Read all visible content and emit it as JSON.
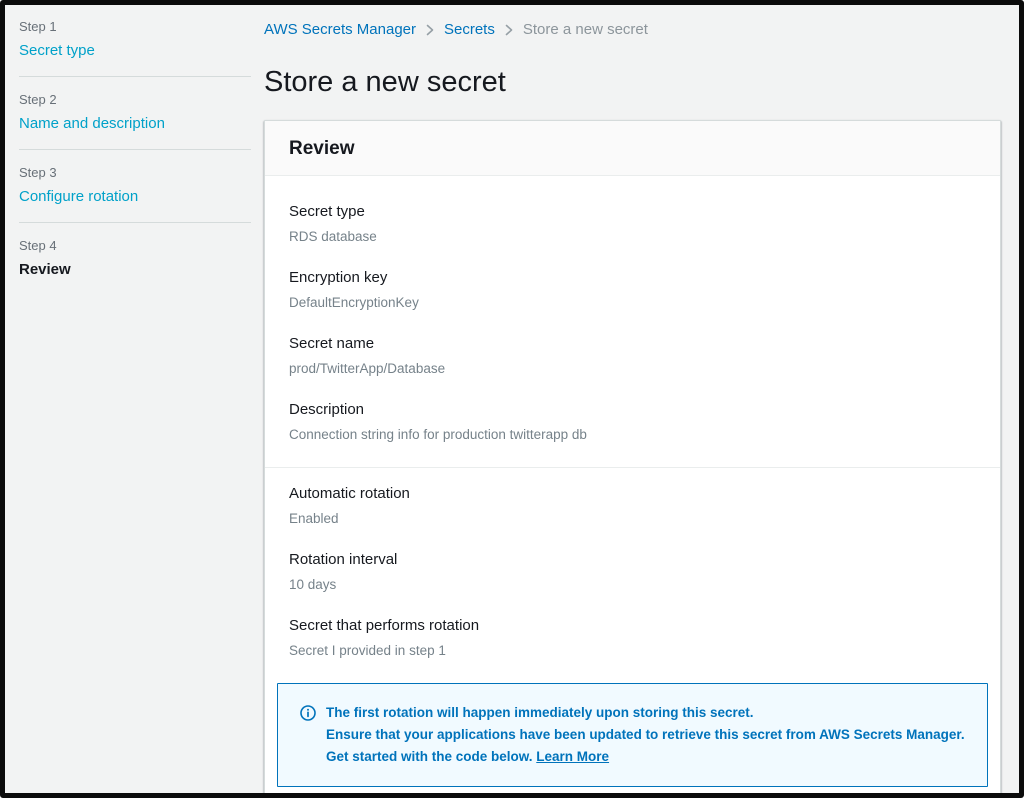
{
  "colors": {
    "frame": "#0b0b0b",
    "page_bg": "#f2f3f3",
    "sidebar_link": "#00a1c9",
    "breadcrumb_link": "#0073bb",
    "text_dark": "#16191f",
    "text_muted": "#687078",
    "value_gray": "#76828a",
    "divider": "#d5dbdb",
    "card_header_bg": "#fafafa",
    "alert_bg": "#f1faff",
    "alert_blue": "#0073bb"
  },
  "sidebar": {
    "steps": [
      {
        "step": "Step 1",
        "label": "Secret type",
        "current": false
      },
      {
        "step": "Step 2",
        "label": "Name and description",
        "current": false
      },
      {
        "step": "Step 3",
        "label": "Configure rotation",
        "current": false
      },
      {
        "step": "Step 4",
        "label": "Review",
        "current": true
      }
    ]
  },
  "breadcrumb": {
    "items": [
      {
        "label": "AWS Secrets Manager"
      },
      {
        "label": "Secrets"
      },
      {
        "label": "Store a new secret"
      }
    ]
  },
  "page": {
    "title": "Store a new secret"
  },
  "panel": {
    "title": "Review",
    "sections": [
      {
        "fields": [
          {
            "label": "Secret type",
            "value": "RDS database"
          },
          {
            "label": "Encryption key",
            "value": "DefaultEncryptionKey"
          },
          {
            "label": "Secret name",
            "value": "prod/TwitterApp/Database"
          },
          {
            "label": "Description",
            "value": "Connection string info for production twitterapp db"
          }
        ]
      },
      {
        "fields": [
          {
            "label": "Automatic rotation",
            "value": "Enabled"
          },
          {
            "label": "Rotation interval",
            "value": "10 days"
          },
          {
            "label": "Secret that performs rotation",
            "value": "Secret I provided in step 1"
          }
        ]
      }
    ],
    "alert": {
      "icon": "info-icon",
      "line1": "The first rotation will happen immediately upon storing this secret.",
      "line2": "Ensure that your applications have been updated to retrieve this secret from AWS Secrets Manager. Get started with the code below. ",
      "link_label": "Learn More"
    }
  }
}
